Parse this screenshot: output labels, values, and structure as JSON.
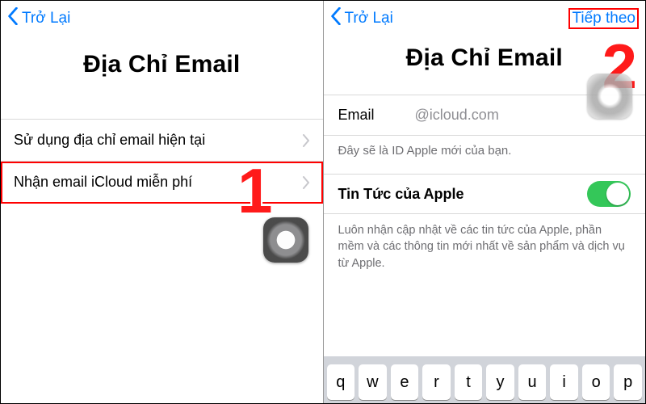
{
  "pane1": {
    "back_label": "Trở Lại",
    "title": "Địa Chỉ Email",
    "options": [
      {
        "label": "Sử dụng địa chỉ email hiện tại"
      },
      {
        "label": "Nhận email iCloud miễn phí"
      }
    ],
    "step_number": "1"
  },
  "pane2": {
    "back_label": "Trở Lại",
    "next_label": "Tiếp theo",
    "title": "Địa Chỉ Email",
    "email_label": "Email",
    "email_value": "@icloud.com",
    "email_hint": "Đây sẽ là ID Apple mới của bạn.",
    "news_label": "Tin Tức của Apple",
    "news_desc": "Luôn nhận cập nhật về các tin tức của Apple, phần mềm và các thông tin mới nhất về sản phẩm và dịch vụ từ Apple.",
    "step_number": "2",
    "keyboard_keys": [
      "q",
      "w",
      "e",
      "r",
      "t",
      "y",
      "u",
      "i",
      "o",
      "p"
    ]
  }
}
